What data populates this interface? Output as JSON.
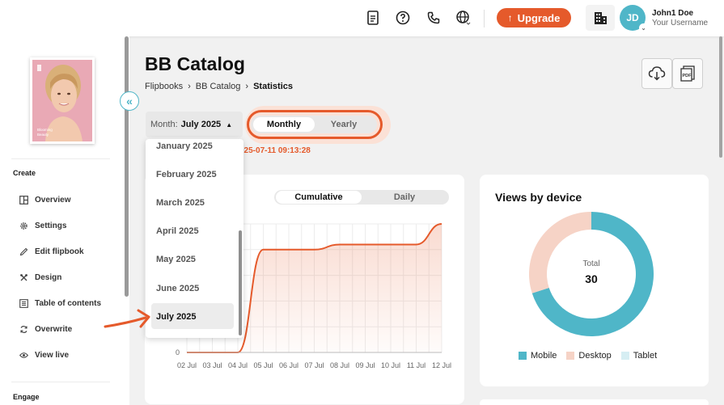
{
  "topbar": {
    "upgrade_label": "Upgrade",
    "avatar_initials": "JD",
    "user_name": "John1 Doe",
    "user_sub": "Your Username"
  },
  "cover": {
    "caption_line1": "Blooming",
    "caption_line2": "Beauty"
  },
  "sidebar": {
    "section_create": "Create",
    "items": [
      {
        "label": "Overview",
        "icon": "layout-icon"
      },
      {
        "label": "Settings",
        "icon": "gear-icon"
      },
      {
        "label": "Edit flipbook",
        "icon": "pencil-icon"
      },
      {
        "label": "Design",
        "icon": "brush-icon"
      },
      {
        "label": "Table of contents",
        "icon": "list-icon"
      },
      {
        "label": "Overwrite",
        "icon": "refresh-icon"
      },
      {
        "label": "View live",
        "icon": "eye-icon"
      }
    ],
    "section_engage": "Engage"
  },
  "page": {
    "title": "BB Catalog",
    "breadcrumb": [
      "Flipbooks",
      "BB Catalog",
      "Statistics"
    ]
  },
  "filters": {
    "month_label": "Month:",
    "month_value": "July 2025",
    "period_active": "Monthly",
    "period_other": "Yearly",
    "timestamp": "025-07-11 09:13:28"
  },
  "dropdown": {
    "options": [
      "January 2025",
      "February 2025",
      "March 2025",
      "April 2025",
      "May 2025",
      "June 2025"
    ],
    "selected": "July 2025"
  },
  "views_chart": {
    "toggle_active": "Cumulative",
    "toggle_other": "Daily"
  },
  "device": {
    "title": "Views by device",
    "total_label": "Total",
    "total_value": "30",
    "legend": [
      "Mobile",
      "Desktop",
      "Tablet"
    ]
  },
  "colors": {
    "accent": "#e55a2b",
    "mobile": "#4fb6c8",
    "desktop": "#f6d3c6",
    "tablet": "#d6eef3"
  },
  "chart_data": [
    {
      "type": "area",
      "title": "",
      "x": [
        "02 Jul",
        "03 Jul",
        "04 Jul",
        "05 Jul",
        "06 Jul",
        "07 Jul",
        "08 Jul",
        "09 Jul",
        "10 Jul",
        "11 Jul",
        "12 Jul"
      ],
      "series": [
        {
          "values": [
            0,
            0,
            0,
            20,
            20,
            20,
            21,
            21,
            21,
            21,
            25
          ]
        }
      ],
      "y_tick_labels": [
        "0"
      ],
      "ylim": [
        0,
        25
      ],
      "grid": true
    },
    {
      "type": "pie",
      "title": "Views by device",
      "categories": [
        "Mobile",
        "Desktop",
        "Tablet"
      ],
      "values": [
        21,
        9,
        0
      ],
      "total": 30
    }
  ]
}
